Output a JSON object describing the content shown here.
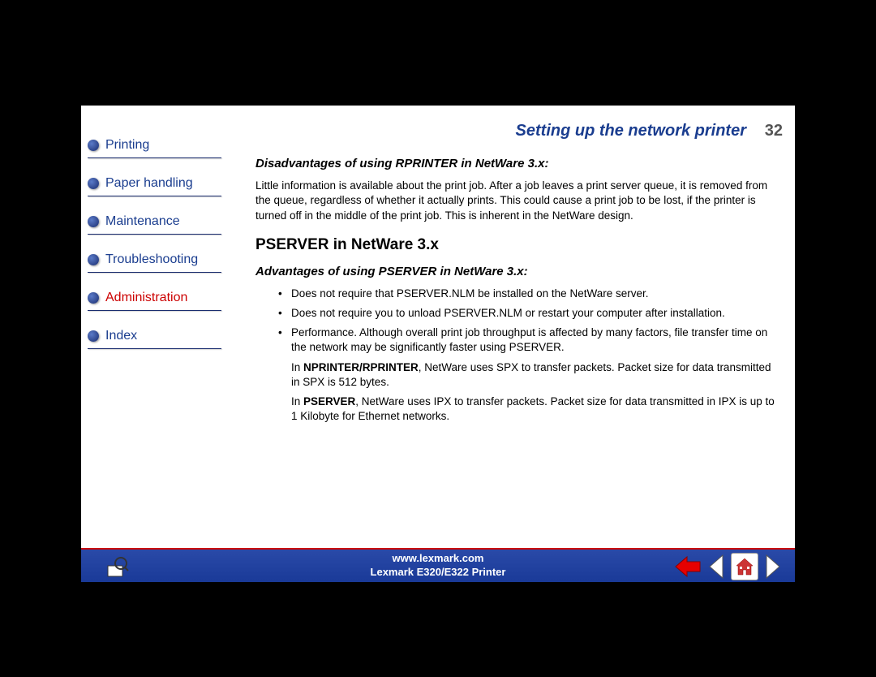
{
  "header": {
    "title": "Setting up the network printer",
    "page_number": "32"
  },
  "nav": {
    "items": [
      {
        "label": "Printing",
        "active": false
      },
      {
        "label": "Paper handling",
        "active": false
      },
      {
        "label": "Maintenance",
        "active": false
      },
      {
        "label": "Troubleshooting",
        "active": false
      },
      {
        "label": "Administration",
        "active": true
      },
      {
        "label": "Index",
        "active": false
      }
    ]
  },
  "content": {
    "subh1": "Disadvantages of using RPRINTER in NetWare 3.x:",
    "para1": "Little information is available about the print job. After a job leaves a print server queue, it is removed from the queue, regardless of whether it actually prints. This could cause a print job to be lost, if the printer is turned off in the middle of the print job. This is inherent in the NetWare design.",
    "h2": "PSERVER in NetWare 3.x",
    "subh2": "Advantages of using PSERVER in NetWare 3.x:",
    "bullets": [
      "Does not require that PSERVER.NLM be installed on the NetWare server.",
      "Does not require you to unload PSERVER.NLM or restart your computer after installation.",
      "Performance. Although overall print job throughput is affected by many factors, file transfer time on the network may be significantly faster using PSERVER."
    ],
    "indent1_pre": "In ",
    "indent1_bold": "NPRINTER/RPRINTER",
    "indent1_post": ", NetWare uses SPX to transfer packets. Packet size for data transmitted in SPX is 512 bytes.",
    "indent2_pre": "In ",
    "indent2_bold": "PSERVER",
    "indent2_post": ", NetWare uses IPX to transfer packets. Packet size for data transmitted in IPX is up to 1 Kilobyte for Ethernet networks."
  },
  "footer": {
    "url": "www.lexmark.com",
    "model": "Lexmark E320/E322 Printer"
  }
}
